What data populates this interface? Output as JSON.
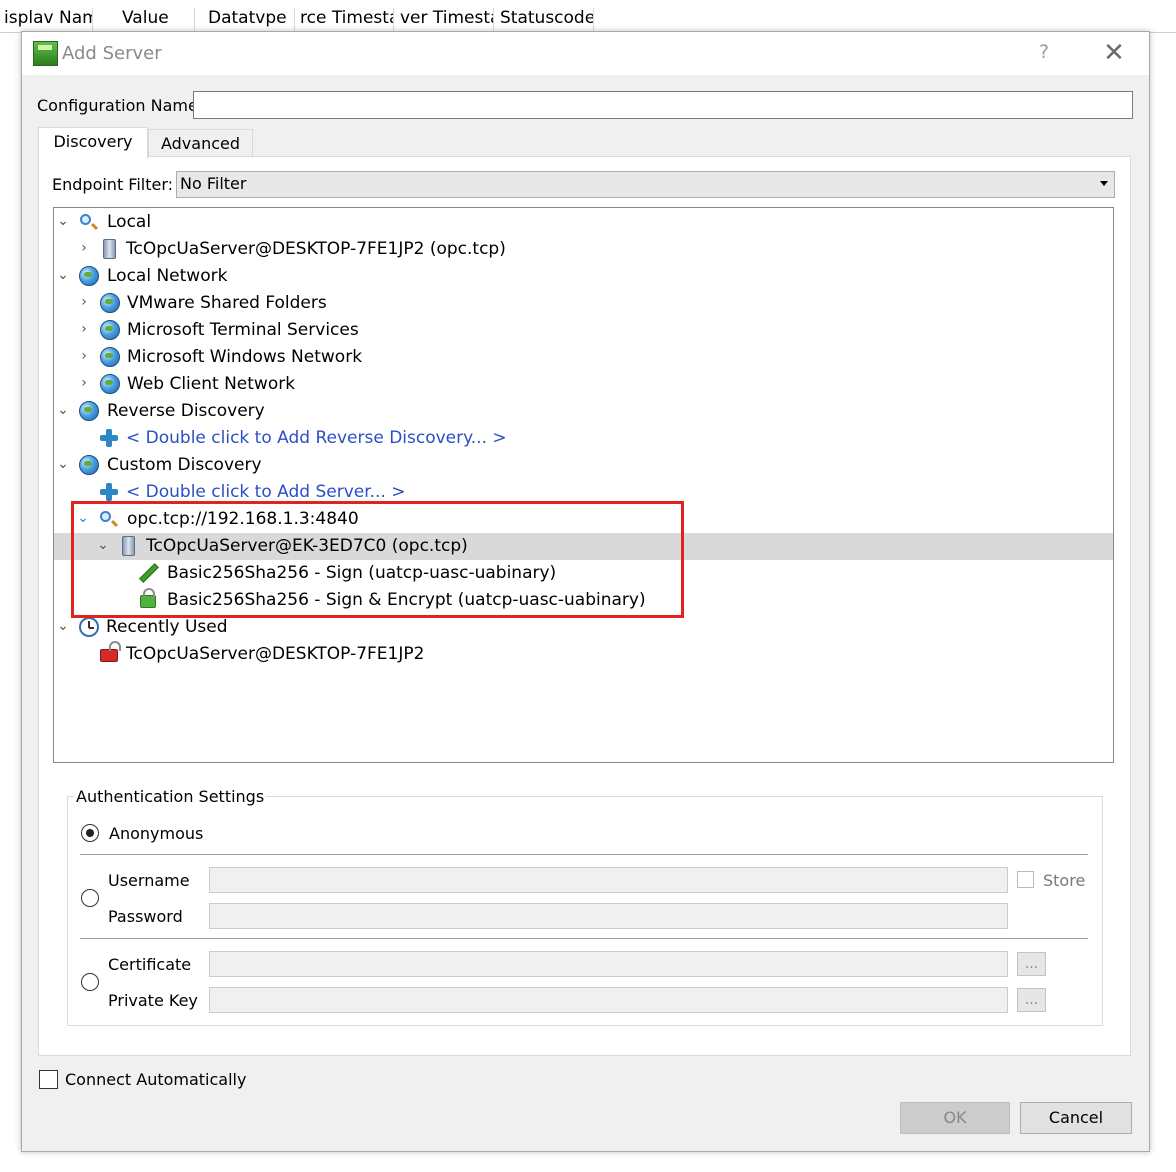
{
  "background_table": {
    "columns": [
      "isplav Nam",
      "Value",
      "Datatvpe",
      "rce Timesta",
      "ver Timesta",
      "Statuscode"
    ]
  },
  "dialog": {
    "title": "Add Server",
    "help_label": "?",
    "close_label": "✕"
  },
  "config": {
    "label": "Configuration Name",
    "value": ""
  },
  "tabs": [
    {
      "label": "Discovery",
      "active": true
    },
    {
      "label": "Advanced",
      "active": false
    }
  ],
  "filter": {
    "label": "Endpoint Filter:",
    "value": "No Filter"
  },
  "tree": {
    "local": {
      "label": "Local",
      "icon": "search-icon"
    },
    "local_server": {
      "label": "TcOpcUaServer@DESKTOP-7FE1JP2 (opc.tcp)",
      "icon": "server-icon"
    },
    "local_network": {
      "label": "Local Network",
      "icon": "globe-icon"
    },
    "vmware": {
      "label": "VMware Shared Folders",
      "icon": "globe-icon"
    },
    "ms_terminal": {
      "label": "Microsoft Terminal Services",
      "icon": "globe-icon"
    },
    "ms_windows": {
      "label": "Microsoft Windows Network",
      "icon": "globe-icon"
    },
    "web_client": {
      "label": "Web Client Network",
      "icon": "globe-icon"
    },
    "reverse": {
      "label": "Reverse Discovery",
      "icon": "globe-icon"
    },
    "reverse_add": {
      "label": "< Double click to Add Reverse Discovery... >",
      "icon": "plus-icon"
    },
    "custom": {
      "label": "Custom Discovery",
      "icon": "globe-icon"
    },
    "custom_add": {
      "label": "< Double click to Add Server... >",
      "icon": "plus-icon"
    },
    "endpoint": {
      "label": "opc.tcp://192.168.1.3:4840",
      "icon": "search-icon"
    },
    "ek_server": {
      "label": "TcOpcUaServer@EK-3ED7C0 (opc.tcp)",
      "icon": "server-icon"
    },
    "sign": {
      "label": "Basic256Sha256 - Sign (uatcp-uasc-uabinary)",
      "icon": "pencil-icon"
    },
    "sign_encrypt": {
      "label": "Basic256Sha256 - Sign & Encrypt (uatcp-uasc-uabinary)",
      "icon": "lock-icon"
    },
    "recent": {
      "label": "Recently Used",
      "icon": "clock-icon"
    },
    "recent_server": {
      "label": "TcOpcUaServer@DESKTOP-7FE1JP2",
      "icon": "unlocked-icon"
    }
  },
  "auth": {
    "title": "Authentication Settings",
    "anonymous": "Anonymous",
    "username": "Username",
    "password": "Password",
    "store": "Store",
    "certificate": "Certificate",
    "private_key": "Private Key",
    "browse": "...",
    "selected": "Anonymous"
  },
  "footer": {
    "connect_auto": "Connect Automatically",
    "ok": "OK",
    "cancel": "Cancel"
  },
  "colors": {
    "highlight_border": "#e0241c",
    "link_text": "#2b4fc4",
    "selected_row": "#d9d9d9"
  }
}
